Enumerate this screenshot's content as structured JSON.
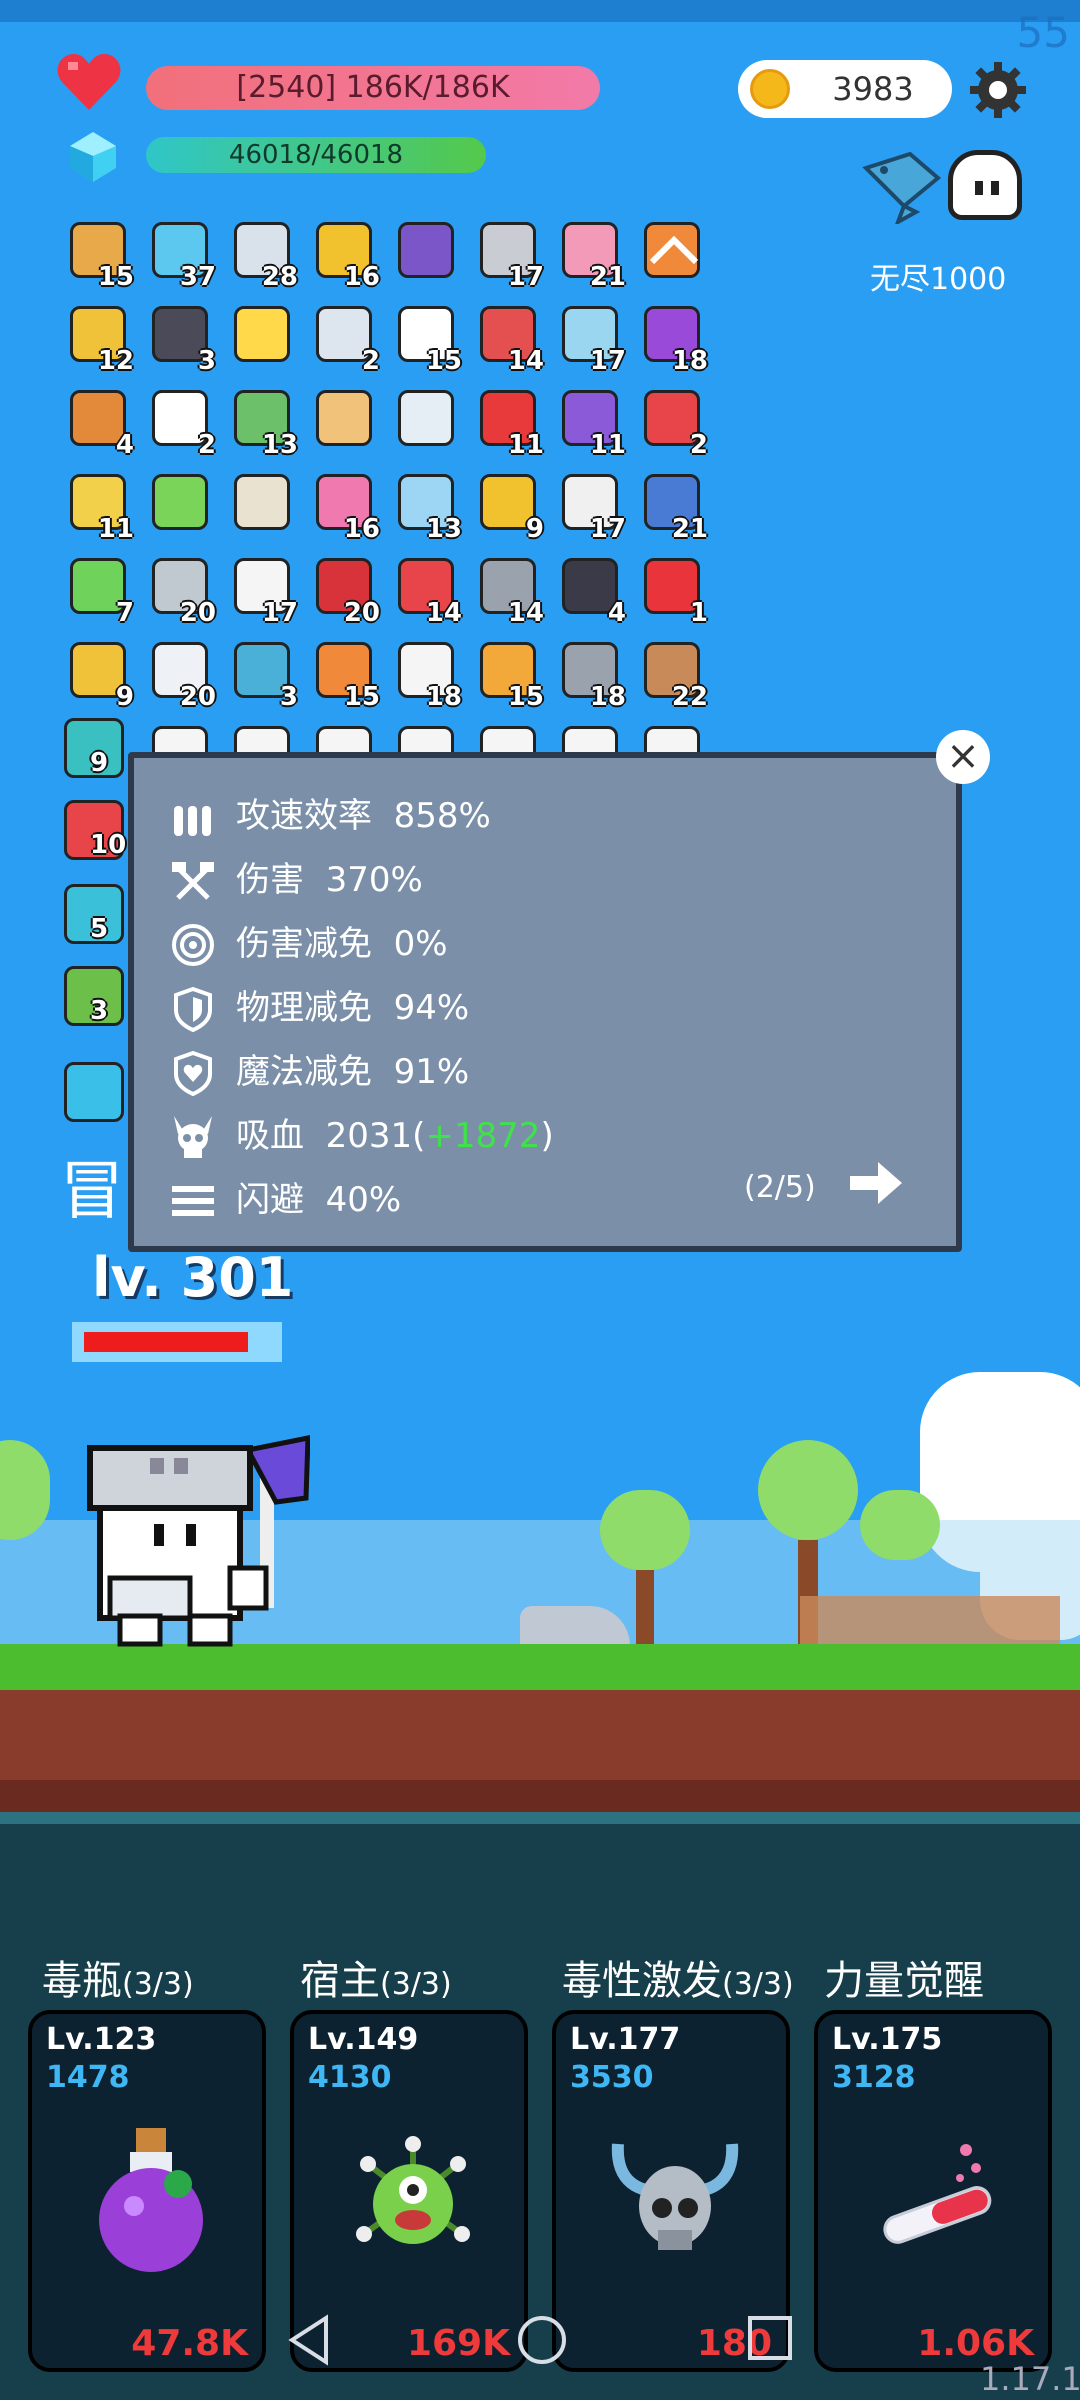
{
  "corner_number": "55",
  "hp": {
    "text": "[2540] 186K/186K"
  },
  "mp": {
    "text": "46018/46018"
  },
  "gold": {
    "value": "3983"
  },
  "mode": {
    "label": "无尽1000"
  },
  "items": [
    {
      "c": "15",
      "col": "#e7a94a"
    },
    {
      "c": "37",
      "col": "#5cc8f0"
    },
    {
      "c": "28",
      "col": "#d9e2ea"
    },
    {
      "c": "16",
      "col": "#f2c12e"
    },
    {
      "c": "",
      "col": "#7a56c9"
    },
    {
      "c": "17",
      "col": "#c9ccd2"
    },
    {
      "c": "21",
      "col": "#f29ab8"
    },
    {
      "c": "",
      "col": "#f08a3a"
    },
    {
      "c": "12",
      "col": "#f0c23a"
    },
    {
      "c": "3",
      "col": "#4a4a58"
    },
    {
      "c": "",
      "col": "#ffd94a"
    },
    {
      "c": "2",
      "col": "#dde5ee"
    },
    {
      "c": "15",
      "col": "#ffffff"
    },
    {
      "c": "14",
      "col": "#e45050"
    },
    {
      "c": "17",
      "col": "#9ad6ef"
    },
    {
      "c": "18",
      "col": "#9a4ad8"
    },
    {
      "c": "4",
      "col": "#e38a3a"
    },
    {
      "c": "2",
      "col": "#ffffff"
    },
    {
      "c": "13",
      "col": "#6cc06a"
    },
    {
      "c": "",
      "col": "#f0c27a"
    },
    {
      "c": "",
      "col": "#e5eef5"
    },
    {
      "c": "11",
      "col": "#e83a3a"
    },
    {
      "c": "11",
      "col": "#8a5ad9"
    },
    {
      "c": "2",
      "col": "#e8454a"
    },
    {
      "c": "11",
      "col": "#f3d04a"
    },
    {
      "c": "",
      "col": "#7bd45a"
    },
    {
      "c": "",
      "col": "#e9e2d0"
    },
    {
      "c": "16",
      "col": "#f07ab0"
    },
    {
      "c": "13",
      "col": "#9dd5f5"
    },
    {
      "c": "9",
      "col": "#f2c12e"
    },
    {
      "c": "17",
      "col": "#f0f0f0"
    },
    {
      "c": "21",
      "col": "#4a7bd4"
    },
    {
      "c": "7",
      "col": "#6fd25a"
    },
    {
      "c": "20",
      "col": "#c0c8d0"
    },
    {
      "c": "17",
      "col": "#f5f5f5"
    },
    {
      "c": "20",
      "col": "#d8333a"
    },
    {
      "c": "14",
      "col": "#e8454a"
    },
    {
      "c": "14",
      "col": "#9aa2ae"
    },
    {
      "c": "4",
      "col": "#3a3a48"
    },
    {
      "c": "1",
      "col": "#e8343a"
    },
    {
      "c": "9",
      "col": "#f0c23a"
    },
    {
      "c": "20",
      "col": "#eef2f6"
    },
    {
      "c": "3",
      "col": "#4ab0d8"
    },
    {
      "c": "15",
      "col": "#f08a3a"
    },
    {
      "c": "18",
      "col": "#f5f5f5"
    },
    {
      "c": "15",
      "col": "#f2a93a"
    },
    {
      "c": "18",
      "col": "#9aa2ae"
    },
    {
      "c": "22",
      "col": "#c98a5a"
    }
  ],
  "side_items": [
    {
      "c": "9",
      "col": "#3ac0c0"
    },
    {
      "c": "10",
      "col": "#e8454a"
    },
    {
      "c": "5",
      "col": "#3ac0d8"
    },
    {
      "c": "3",
      "col": "#6cc04a"
    },
    {
      "c": "",
      "col": "#3ac0e8"
    }
  ],
  "hidden_char": "冒",
  "enemy": {
    "level": "lv. 301",
    "hp_fraction": 0.88
  },
  "stats": {
    "attack_speed": {
      "label": "攻速效率",
      "value": "858%"
    },
    "damage": {
      "label": "伤害",
      "value": "370%"
    },
    "dmg_reduce": {
      "label": "伤害减免",
      "value": "0%"
    },
    "phys_reduce": {
      "label": "物理减免",
      "value": "94%"
    },
    "magic_reduce": {
      "label": "魔法减免",
      "value": "91%"
    },
    "lifesteal": {
      "label": "吸血",
      "value": "2031",
      "bonus_open": "(",
      "bonus": "+1872",
      "bonus_close": ")"
    },
    "dodge": {
      "label": "闪避",
      "value": "40%"
    },
    "page": "(2/5)"
  },
  "skills": [
    {
      "name": "毒瓶",
      "count": "(3/3)",
      "lv": "Lv.123",
      "power": "1478",
      "cost": "47.8K"
    },
    {
      "name": "宿主",
      "count": "(3/3)",
      "lv": "Lv.149",
      "power": "4130",
      "cost": "169K"
    },
    {
      "name": "毒性激发",
      "count": "(3/3)",
      "lv": "Lv.177",
      "power": "3530",
      "cost": "180"
    },
    {
      "name": "力量觉醒",
      "count": "",
      "lv": "Lv.175",
      "power": "3128",
      "cost": "1.06K"
    }
  ],
  "version": "1.17.1"
}
